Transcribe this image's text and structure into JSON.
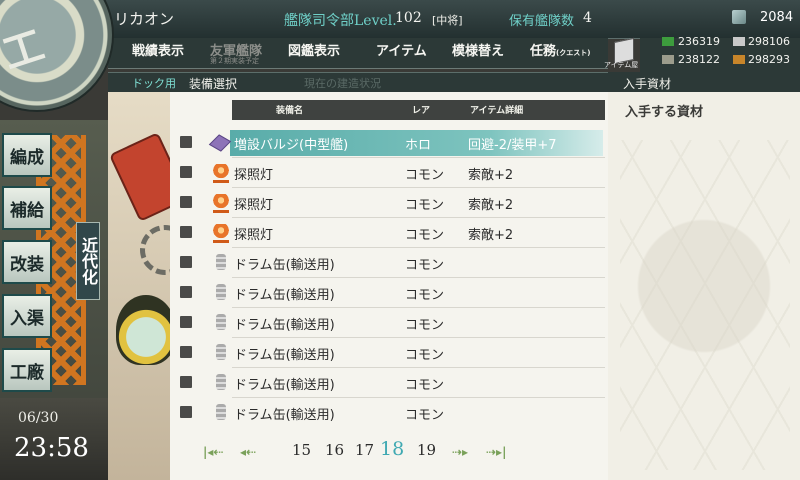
{
  "header": {
    "admiral_name": "リカオン",
    "hq_level_label": "艦隊司令部Level.",
    "hq_level": "102",
    "rank": "[中将]",
    "ships_label": "保有艦隊数",
    "ships_count": "4",
    "furniture_coins": "2084"
  },
  "menu": {
    "items": [
      {
        "label": "戦績表示"
      },
      {
        "label": "友軍艦隊",
        "sub": "第２期実装予定"
      },
      {
        "label": "図鑑表示"
      },
      {
        "label": "アイテム"
      },
      {
        "label": "模様替え"
      },
      {
        "label": "任務",
        "tag": "(クエスト)"
      }
    ],
    "item_shop_label": "アイテム屋"
  },
  "resources": {
    "fuel": "236319",
    "ammo": "298106",
    "steel": "238122",
    "bauxite": "298293",
    "colors": {
      "fuel": "#3d9c3d",
      "ammo": "#b9b9b9",
      "steel": "#9a9a9a",
      "bauxite": "#c8852a"
    }
  },
  "subheader": {
    "dock_label": "ドック用",
    "select_label": "装備選択",
    "ghost_label": "現在の建造状況",
    "obtain_head": "入手資材"
  },
  "sidebar": {
    "items": [
      {
        "label": "編成"
      },
      {
        "label": "補給"
      },
      {
        "label": "改装"
      },
      {
        "label": "入渠"
      },
      {
        "label": "工廠"
      }
    ],
    "modernize": "近代化"
  },
  "clock": {
    "date": "06/30",
    "time": "23:58"
  },
  "equipment_list": {
    "columns": {
      "name": "装備名",
      "rarity": "レア",
      "details": "アイテム詳細"
    },
    "rows": [
      {
        "icon": "bulge-icon",
        "name": "増設バルジ(中型艦)",
        "rarity": "ホロ",
        "details": "回避-2/装甲+7",
        "selected": true
      },
      {
        "icon": "searchlight-icon",
        "name": "探照灯",
        "rarity": "コモン",
        "details": "索敵+2"
      },
      {
        "icon": "searchlight-icon",
        "name": "探照灯",
        "rarity": "コモン",
        "details": "索敵+2"
      },
      {
        "icon": "searchlight-icon",
        "name": "探照灯",
        "rarity": "コモン",
        "details": "索敵+2"
      },
      {
        "icon": "drum-icon",
        "name": "ドラム缶(輸送用)",
        "rarity": "コモン",
        "details": ""
      },
      {
        "icon": "drum-icon",
        "name": "ドラム缶(輸送用)",
        "rarity": "コモン",
        "details": ""
      },
      {
        "icon": "drum-icon",
        "name": "ドラム缶(輸送用)",
        "rarity": "コモン",
        "details": ""
      },
      {
        "icon": "drum-icon",
        "name": "ドラム缶(輸送用)",
        "rarity": "コモン",
        "details": ""
      },
      {
        "icon": "drum-icon",
        "name": "ドラム缶(輸送用)",
        "rarity": "コモン",
        "details": ""
      },
      {
        "icon": "drum-icon",
        "name": "ドラム缶(輸送用)",
        "rarity": "コモン",
        "details": ""
      }
    ]
  },
  "pagination": {
    "pages": [
      "15",
      "16",
      "17",
      "18",
      "19"
    ],
    "current": "18"
  },
  "right_panel": {
    "obtain_title": "入手する資材"
  }
}
